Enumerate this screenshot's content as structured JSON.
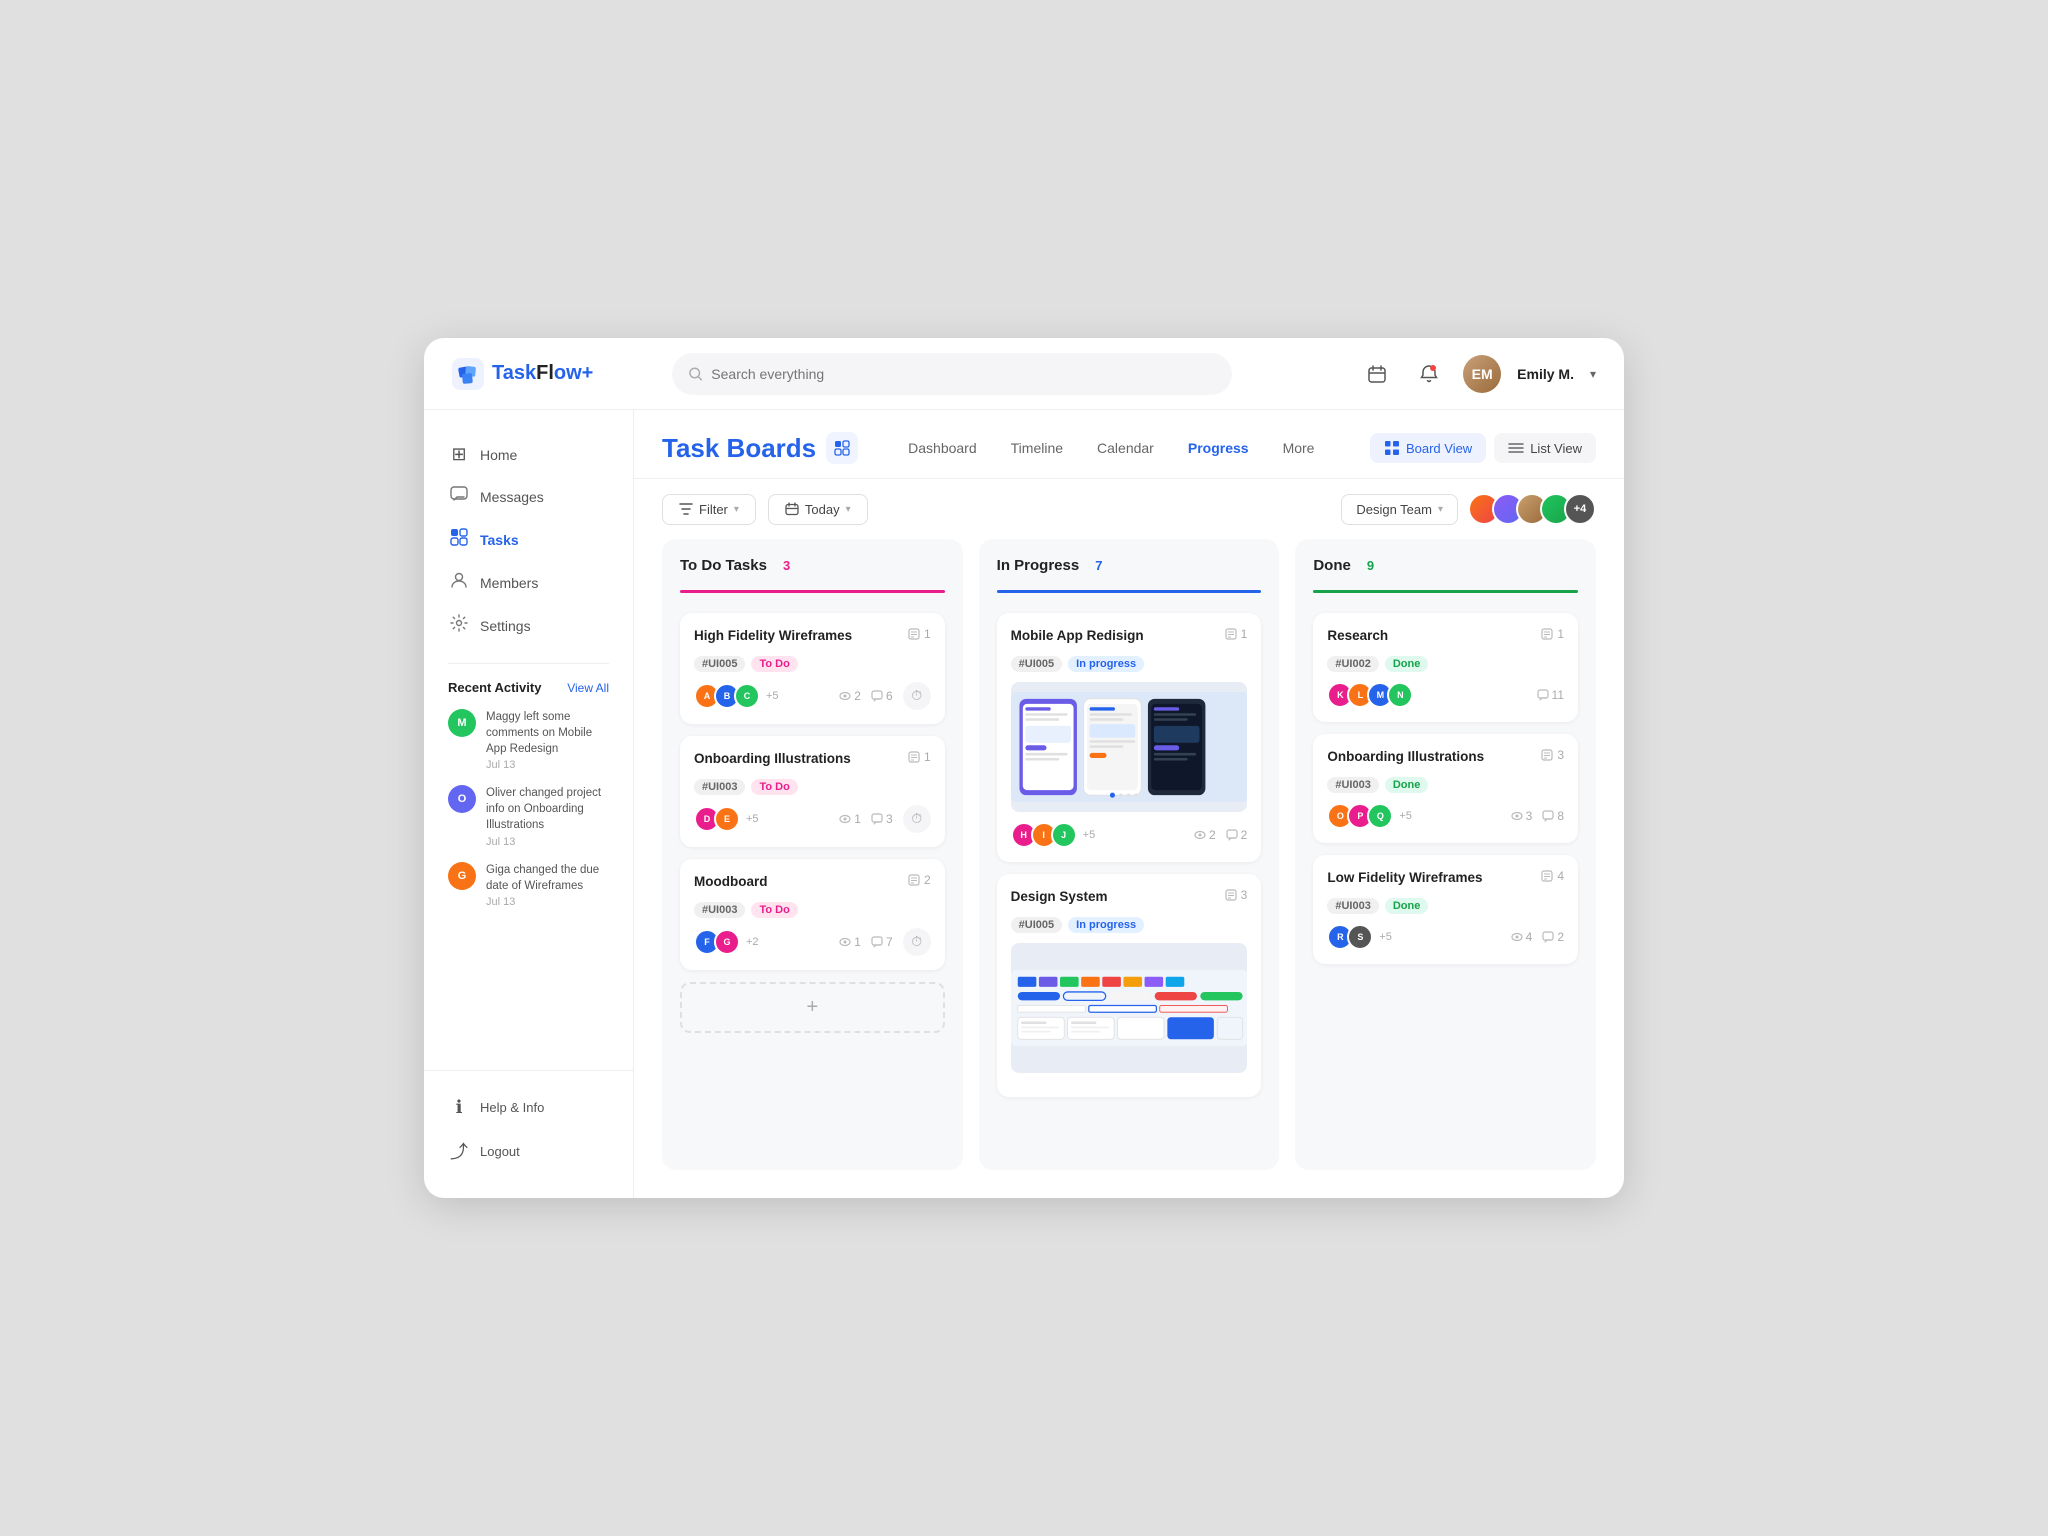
{
  "app": {
    "name": "TaskFlow+",
    "logo_color": "#2563eb"
  },
  "header": {
    "search_placeholder": "Search everything",
    "user_name": "Emily M.",
    "user_initials": "EM"
  },
  "sidebar": {
    "nav_items": [
      {
        "id": "home",
        "label": "Home",
        "icon": "⊞"
      },
      {
        "id": "messages",
        "label": "Messages",
        "icon": "💬"
      },
      {
        "id": "tasks",
        "label": "Tasks",
        "icon": "📋",
        "active": true
      },
      {
        "id": "members",
        "label": "Members",
        "icon": "👤"
      },
      {
        "id": "settings",
        "label": "Settings",
        "icon": "⚙"
      }
    ],
    "recent_activity": {
      "title": "Recent Activity",
      "view_all": "View All",
      "items": [
        {
          "user": "Maggy",
          "color": "#22c55e",
          "initials": "M",
          "text": "Maggy left some comments on Mobile App Redesign",
          "date": "Jul 13"
        },
        {
          "user": "Oliver",
          "color": "#6366f1",
          "initials": "O",
          "text": "Oliver changed project info on Onboarding Illustrations",
          "date": "Jul 13"
        },
        {
          "user": "Giga",
          "color": "#f97316",
          "initials": "G",
          "text": "Giga changed the due date of Wireframes",
          "date": "Jul 13"
        }
      ]
    },
    "bottom_items": [
      {
        "id": "help",
        "label": "Help & Info",
        "icon": "ℹ"
      },
      {
        "id": "logout",
        "label": "Logout",
        "icon": "→"
      }
    ]
  },
  "page": {
    "title": "Task Boards",
    "nav_items": [
      {
        "id": "dashboard",
        "label": "Dashboard",
        "active": false
      },
      {
        "id": "timeline",
        "label": "Timeline",
        "active": false
      },
      {
        "id": "calendar",
        "label": "Calendar",
        "active": false
      },
      {
        "id": "progress",
        "label": "Progress",
        "active": true
      },
      {
        "id": "more",
        "label": "More",
        "active": false
      }
    ],
    "views": [
      {
        "id": "board",
        "label": "Board View",
        "active": true
      },
      {
        "id": "list",
        "label": "List View",
        "active": false
      }
    ]
  },
  "filters": {
    "filter_label": "Filter",
    "date_label": "Today",
    "team_label": "Design Team",
    "team_extra": "+4"
  },
  "columns": [
    {
      "id": "todo",
      "title": "To Do Tasks",
      "count": "3",
      "color": "#e91e8c",
      "cards": [
        {
          "id": "card-hfw",
          "title": "High Fidelity Wireframes",
          "doc_count": "1",
          "tag_id": "#UI005",
          "tag_status": "To Do",
          "tag_type": "todo",
          "avatars": [
            "#f97316",
            "#2563eb",
            "#22c55e"
          ],
          "extra_avatars": "+5",
          "stats": {
            "eye": "2",
            "comment": "6"
          },
          "has_timer": true
        },
        {
          "id": "card-oi",
          "title": "Onboarding Illustrations",
          "doc_count": "1",
          "tag_id": "#UI003",
          "tag_status": "To Do",
          "tag_type": "todo",
          "avatars": [
            "#e91e8c",
            "#f97316"
          ],
          "extra_avatars": "+5",
          "stats": {
            "eye": "1",
            "comment": "3"
          },
          "has_timer": true
        },
        {
          "id": "card-mb",
          "title": "Moodboard",
          "doc_count": "2",
          "tag_id": "#UI003",
          "tag_status": "To Do",
          "tag_type": "todo",
          "avatars": [
            "#2563eb",
            "#e91e8c"
          ],
          "extra_avatars": "+2",
          "stats": {
            "eye": "1",
            "comment": "7"
          },
          "has_timer": true
        }
      ],
      "add_label": "+"
    },
    {
      "id": "inprogress",
      "title": "In Progress",
      "count": "7",
      "color": "#2563eb",
      "cards": [
        {
          "id": "card-mar",
          "title": "Mobile App Redisign",
          "doc_count": "1",
          "tag_id": "#UI005",
          "tag_status": "In progress",
          "tag_type": "inprogress",
          "avatars": [
            "#e91e8c",
            "#f97316",
            "#22c55e"
          ],
          "extra_avatars": "+5",
          "stats": {
            "eye": "2",
            "comment": "2"
          },
          "has_preview": true,
          "preview_type": "app"
        },
        {
          "id": "card-ds",
          "title": "Design System",
          "doc_count": "3",
          "tag_id": "#UI005",
          "tag_status": "In progress",
          "tag_type": "inprogress",
          "avatars": [],
          "extra_avatars": "",
          "stats": {
            "eye": "",
            "comment": ""
          },
          "has_preview": true,
          "preview_type": "grid"
        }
      ]
    },
    {
      "id": "done",
      "title": "Done",
      "count": "9",
      "color": "#16a34a",
      "cards": [
        {
          "id": "card-res",
          "title": "Research",
          "doc_count": "1",
          "tag_id": "#UI002",
          "tag_status": "Done",
          "tag_type": "done",
          "avatars": [
            "#e91e8c",
            "#f97316",
            "#2563eb",
            "#22c55e"
          ],
          "extra_avatars": "",
          "stats": {
            "eye": "",
            "comment": "11"
          }
        },
        {
          "id": "card-oi2",
          "title": "Onboarding Illustrations",
          "doc_count": "3",
          "tag_id": "#UI003",
          "tag_status": "Done",
          "tag_type": "done",
          "avatars": [
            "#f97316",
            "#e91e8c",
            "#22c55e"
          ],
          "extra_avatars": "+5",
          "stats": {
            "eye": "3",
            "comment": "8"
          }
        },
        {
          "id": "card-lfw",
          "title": "Low Fidelity Wireframes",
          "doc_count": "4",
          "tag_id": "#UI003",
          "tag_status": "Done",
          "tag_type": "done",
          "avatars": [
            "#2563eb",
            "#555"
          ],
          "extra_avatars": "+5",
          "stats": {
            "eye": "4",
            "comment": "2"
          }
        }
      ]
    }
  ]
}
